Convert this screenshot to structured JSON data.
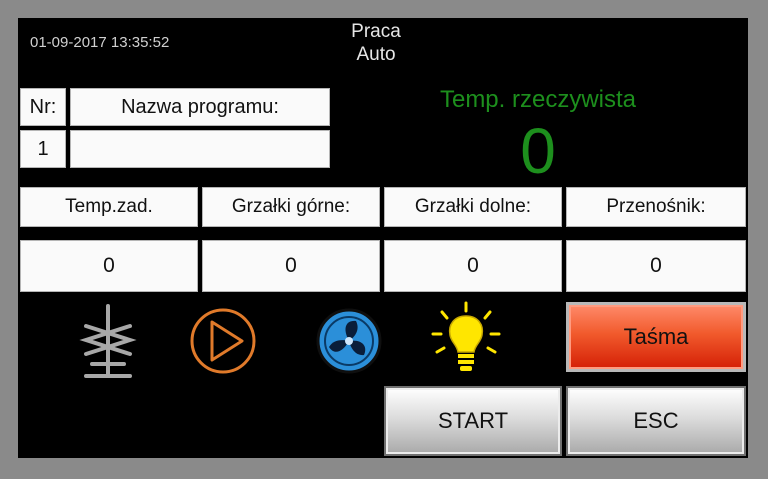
{
  "header": {
    "datetime": "01-09-2017 13:35:52",
    "mode_line1": "Praca",
    "mode_line2": "Auto"
  },
  "program": {
    "nr_label": "Nr:",
    "name_label": "Nazwa programu:",
    "nr_value": "1",
    "name_value": ""
  },
  "temperature": {
    "label": "Temp. rzeczywista",
    "value": "0",
    "color": "#1d8f1d"
  },
  "params": {
    "headers": [
      "Temp.zad.",
      "Grzałki górne:",
      "Grzałki dolne:",
      "Przenośnik:"
    ],
    "values": [
      "0",
      "0",
      "0",
      "0"
    ]
  },
  "icons": [
    "mixer-icon",
    "pump-play-icon",
    "fan-icon",
    "light-bulb-icon"
  ],
  "buttons": {
    "tasma": "Taśma",
    "start": "START",
    "esc": "ESC"
  },
  "colors": {
    "tasma_button": "#e8401a",
    "pump_icon": "#e07a2a",
    "fan_icon": "#2b8fd9",
    "bulb_icon": "#ffe600"
  }
}
